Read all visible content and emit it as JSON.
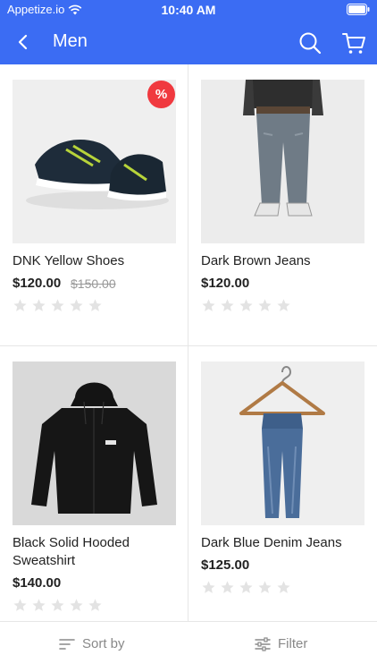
{
  "status_bar": {
    "carrier": "Appetize.io",
    "time": "10:40 AM"
  },
  "header": {
    "title": "Men",
    "back_icon": "chevron-left-icon",
    "search_icon": "search-icon",
    "cart_icon": "cart-icon"
  },
  "products": [
    {
      "name": "DNK Yellow Shoes",
      "price": "$120.00",
      "old_price": "$150.00",
      "badge": "%",
      "rating": 0,
      "image": "sneakers"
    },
    {
      "name": "Dark Brown Jeans",
      "price": "$120.00",
      "rating": 0,
      "image": "jeans-model"
    },
    {
      "name": "Black Solid Hooded Sweatshirt",
      "price": "$140.00",
      "rating": 0,
      "image": "hoodie"
    },
    {
      "name": "Dark Blue Denim Jeans",
      "price": "$125.00",
      "rating": 0,
      "image": "jeans-hanger"
    }
  ],
  "bottom_bar": {
    "sort_label": "Sort by",
    "filter_label": "Filter"
  },
  "colors": {
    "primary": "#3b6cf3",
    "badge": "#f0393f",
    "star_empty": "#e3e3e3"
  }
}
